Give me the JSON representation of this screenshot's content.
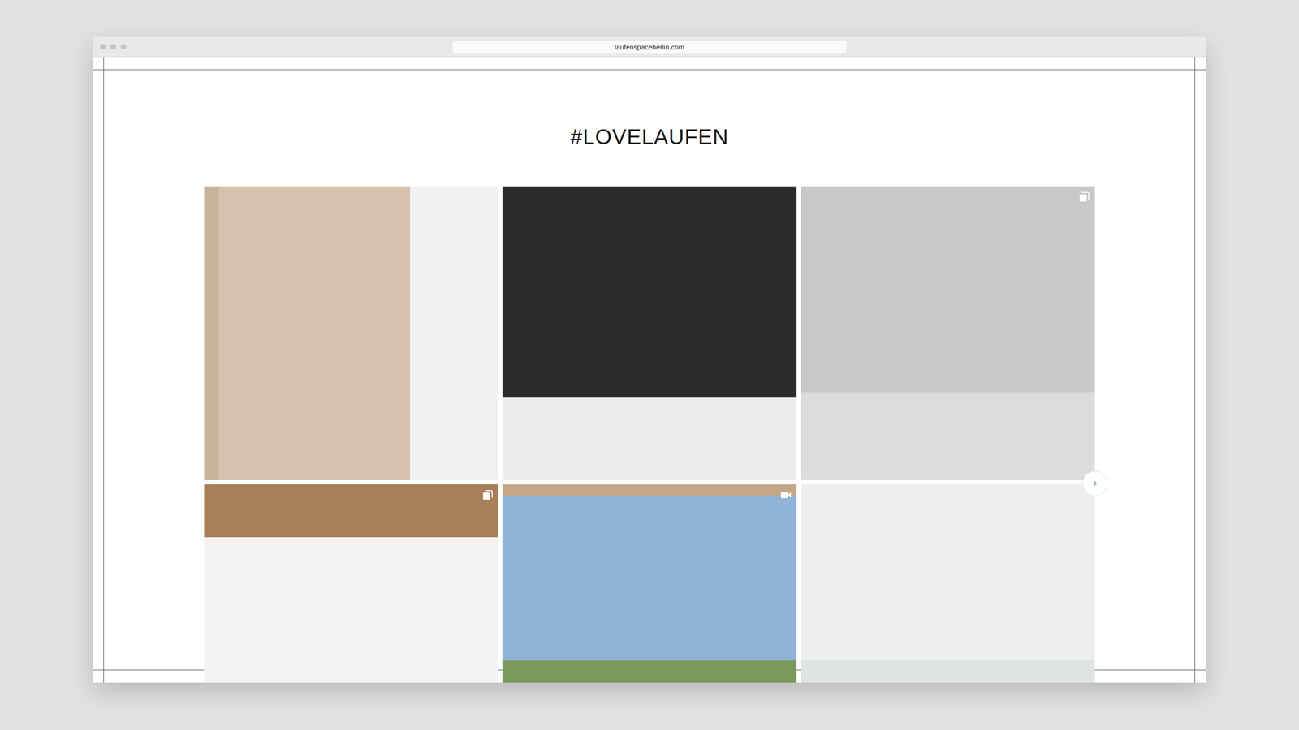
{
  "window": {
    "url": "laufenspaceberlin.com"
  },
  "heading": "#LOVELAUFEN",
  "posts": [
    {
      "kind": "none"
    },
    {
      "kind": "none"
    },
    {
      "kind": "gallery"
    },
    {
      "kind": "gallery"
    },
    {
      "kind": "video"
    },
    {
      "kind": "none"
    }
  ]
}
